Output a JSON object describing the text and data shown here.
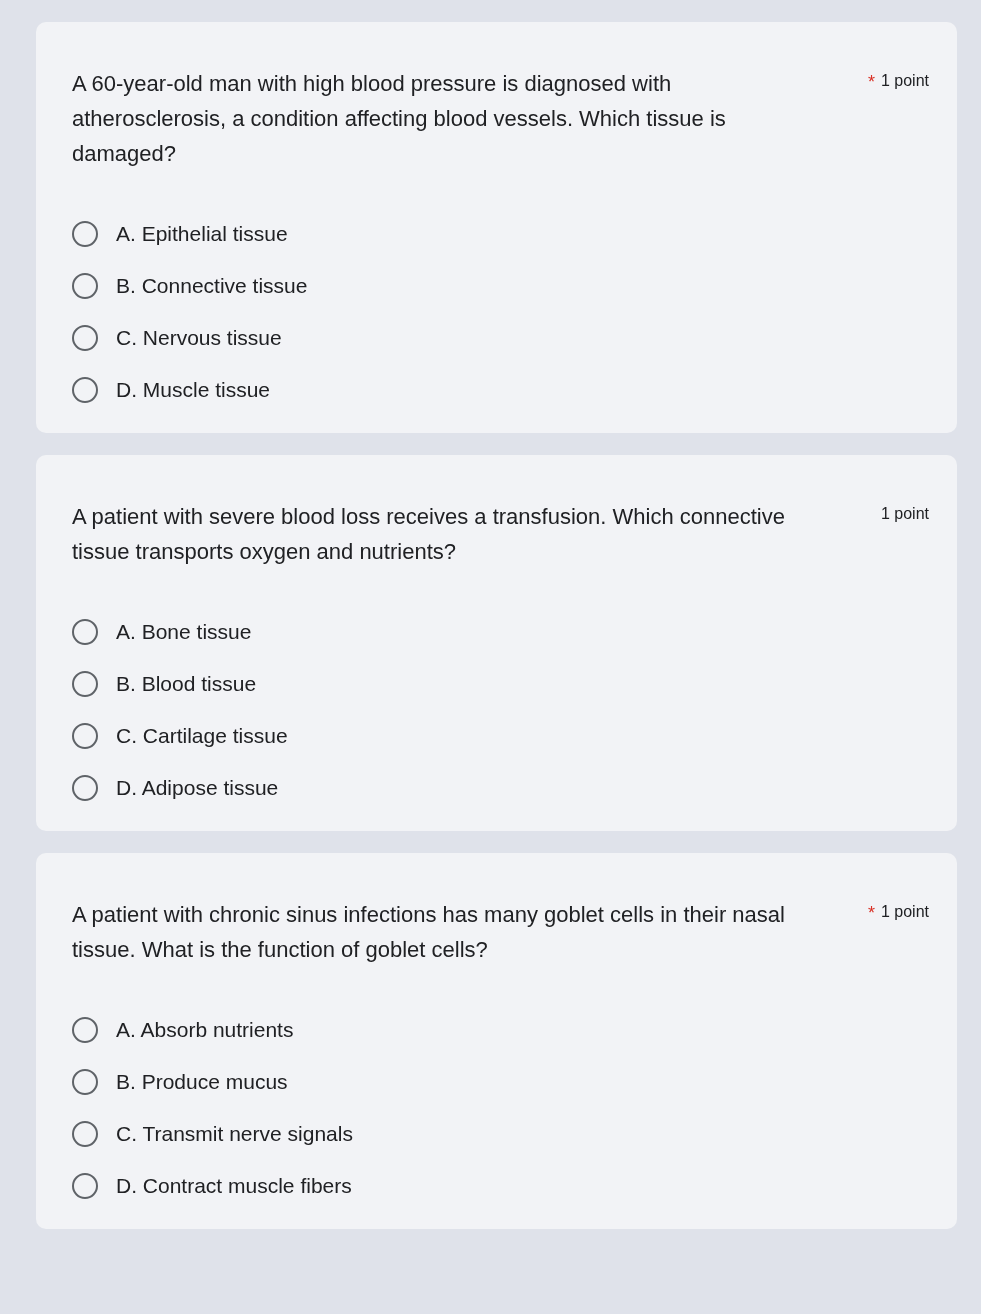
{
  "questions": [
    {
      "text": "A 60-year-old man with high blood pressure is diagnosed with atherosclerosis, a condition affecting blood vessels. Which tissue is damaged?",
      "required_mark": "*",
      "points": "1 point",
      "options": [
        {
          "label": "A. Epithelial tissue",
          "selected": false
        },
        {
          "label": "B. Connective tissue",
          "selected": false
        },
        {
          "label": "C. Nervous tissue",
          "selected": false
        },
        {
          "label": "D. Muscle tissue",
          "selected": false
        }
      ]
    },
    {
      "text": "A patient with severe blood loss receives a transfusion. Which connective tissue transports oxygen and nutrients?",
      "points": "1 point",
      "options": [
        {
          "label": "A. Bone tissue",
          "selected": false
        },
        {
          "label": "B. Blood tissue",
          "selected": false
        },
        {
          "label": "C. Cartilage tissue",
          "selected": false
        },
        {
          "label": "D. Adipose tissue",
          "selected": false
        }
      ]
    },
    {
      "text": "A patient with chronic sinus infections has many goblet cells in their nasal tissue. What is the function of goblet cells?",
      "required_mark": "*",
      "points": "1 point",
      "options": [
        {
          "label": "A. Absorb nutrients",
          "selected": false
        },
        {
          "label": "B. Produce mucus",
          "selected": false
        },
        {
          "label": "C. Transmit nerve signals",
          "selected": false
        },
        {
          "label": "D. Contract muscle fibers",
          "selected": false
        }
      ]
    }
  ]
}
